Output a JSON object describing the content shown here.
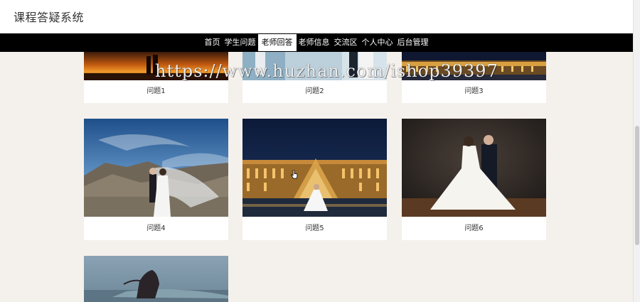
{
  "site": {
    "title": "课程答疑系统"
  },
  "nav": {
    "items": [
      {
        "label": "首页"
      },
      {
        "label": "学生问题"
      },
      {
        "label": "老师回答",
        "active": true
      },
      {
        "label": "老师信息"
      },
      {
        "label": "交流区"
      },
      {
        "label": "个人中心"
      },
      {
        "label": "后台管理"
      }
    ]
  },
  "questions": [
    {
      "title": "问题1"
    },
    {
      "title": "问题2"
    },
    {
      "title": "问题3"
    },
    {
      "title": "问题4"
    },
    {
      "title": "问题5"
    },
    {
      "title": "问题6"
    },
    {
      "title": ""
    }
  ],
  "watermark": "https://www.huzhan.com/ishop39397"
}
